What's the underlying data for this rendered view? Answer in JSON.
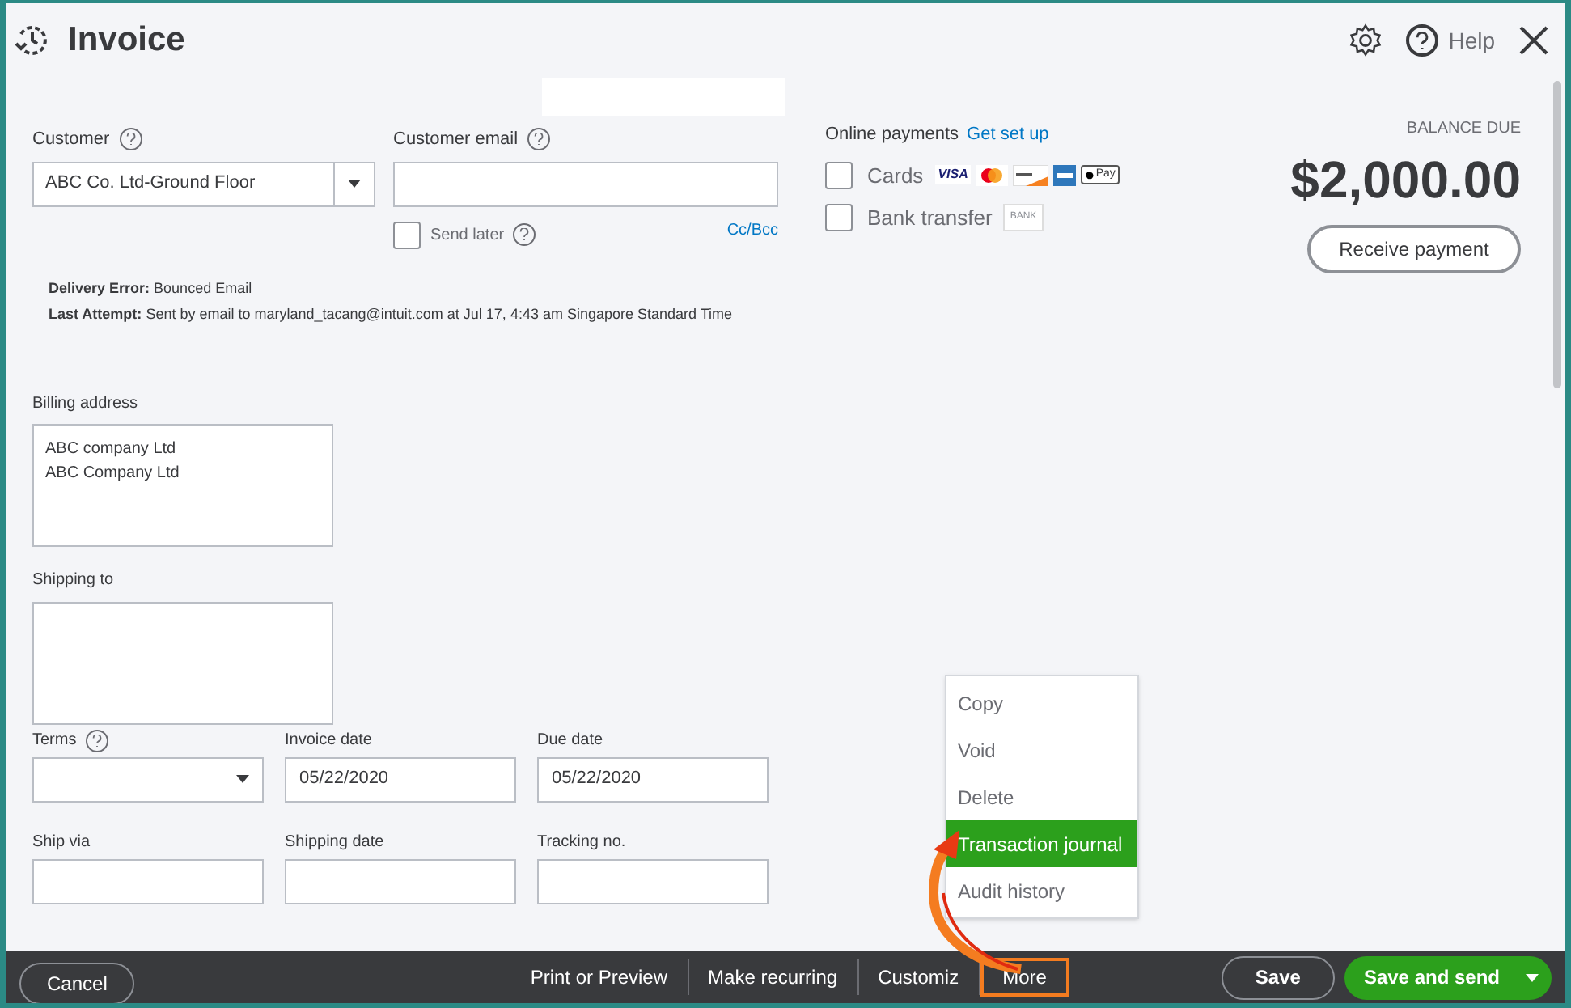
{
  "header": {
    "title": "Invoice",
    "help": "Help"
  },
  "customer": {
    "label": "Customer",
    "value": "ABC Co. Ltd-Ground Floor"
  },
  "customer_email": {
    "label": "Customer email"
  },
  "send_later": {
    "label": "Send later",
    "checked": false
  },
  "cc_bcc": "Cc/Bcc",
  "delivery": [
    {
      "label": "Delivery Error:",
      "text": "Bounced Email"
    },
    {
      "label": "Last Attempt:",
      "text": "Sent by email to maryland_tacang@intuit.com at Jul 17, 4:43 am Singapore Standard Time"
    }
  ],
  "online_payments": {
    "label": "Online payments",
    "link": "Get set up",
    "methods": [
      {
        "kind": "cards",
        "label": "Cards",
        "checked": false,
        "visa": "VISA",
        "applepay": "Pay"
      },
      {
        "kind": "bank",
        "label": "Bank transfer",
        "checked": false,
        "badge": "BANK"
      }
    ]
  },
  "balance": {
    "label": "BALANCE DUE",
    "amount": "$2,000.00",
    "button": "Receive payment"
  },
  "billing_address": {
    "label": "Billing address",
    "lines": [
      "ABC company Ltd",
      "ABC Company Ltd"
    ]
  },
  "shipping_to": {
    "label": "Shipping to"
  },
  "row_fields": [
    [
      {
        "kind": "select",
        "label": "Terms",
        "help": true
      },
      {
        "kind": "text",
        "label": "Invoice date",
        "value": "05/22/2020"
      },
      {
        "kind": "text",
        "label": "Due date",
        "value": "05/22/2020"
      }
    ],
    [
      {
        "kind": "text",
        "label": "Ship via"
      },
      {
        "kind": "text",
        "label": "Shipping date"
      },
      {
        "kind": "text",
        "label": "Tracking no."
      }
    ]
  ],
  "more_menu": [
    {
      "label": "Copy",
      "selected": false
    },
    {
      "label": "Void",
      "selected": false
    },
    {
      "label": "Delete",
      "selected": false
    },
    {
      "label": "Transaction journal",
      "selected": true
    },
    {
      "label": "Audit history",
      "selected": false
    }
  ],
  "footer": {
    "cancel": "Cancel",
    "actions": [
      {
        "label": "Print or Preview",
        "selected": false
      },
      {
        "label": "Make recurring",
        "selected": false
      },
      {
        "label": "Customiz",
        "selected": false
      },
      {
        "label": "More",
        "selected": true
      }
    ],
    "save": "Save",
    "save_and_send": "Save and send"
  }
}
